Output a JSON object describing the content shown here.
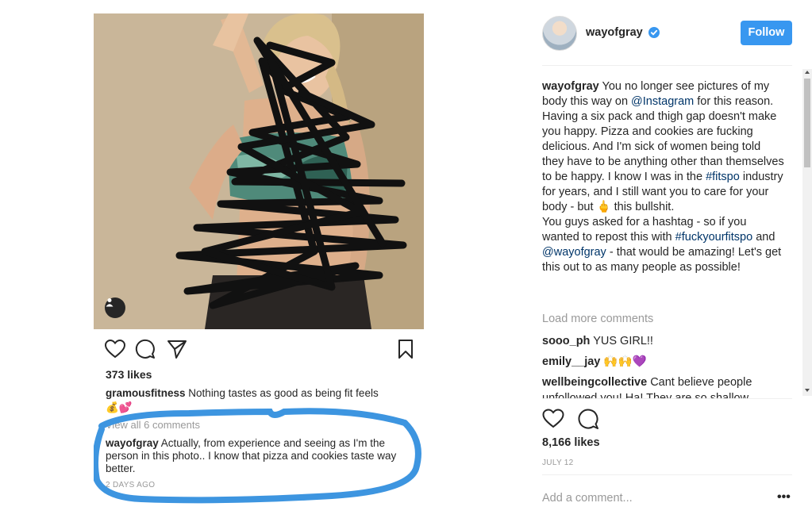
{
  "left_post": {
    "likes": "373 likes",
    "caption": {
      "username": "gramousfitness",
      "text": "Nothing tastes as good as being fit feels 💰💕"
    },
    "view_all_comments": "View all 6 comments",
    "comment": {
      "username": "wayofgray",
      "text": "Actually, from experience and seeing as I'm the person in this photo.. I know that pizza and cookies taste way better."
    },
    "timestamp": "2 DAYS AGO",
    "icons": [
      "heart-icon",
      "comment-icon",
      "share-icon",
      "bookmark-icon",
      "user-tag-icon"
    ],
    "annotation_color": "#3d95e0"
  },
  "post": {
    "username": "wayofgray",
    "follow_label": "Follow",
    "caption": {
      "username": "wayofgray",
      "p1": " You no longer see pictures of my body this way on ",
      "mention1": "@Instagram",
      "p2": " for this reason. Having a six pack and thigh gap doesn't make you happy. Pizza and cookies are fucking delicious. And I'm sick of women being told they have to be anything other than themselves to be happy. I know I was in the ",
      "hashtag1": "#fitspo",
      "p3": " industry for years, and I still want you to care for your body - but 🖕 this bullshit.",
      "p4": "You guys asked for a hashtag - so if you wanted to repost this with ",
      "hashtag2": "#fuckyourfitspo",
      "p5": " and ",
      "mention2": "@wayofgray",
      "p6": " - that would be amazing! Let's get this out to as many people as possible!"
    },
    "load_more": "Load more comments",
    "comments": [
      {
        "username": "sooo_ph",
        "text": "YUS GIRL!!"
      },
      {
        "username": "emily__jay",
        "text": "🙌🙌💜"
      },
      {
        "username": "wellbeingcollective",
        "text": "Cant believe people unfollowed you! Ha! They are so shallow"
      }
    ],
    "likes": "8,166 likes",
    "date": "JULY 12",
    "add_comment_placeholder": "Add a comment...",
    "more_label": "•••",
    "colors": {
      "accent": "#3897f0",
      "link": "#003569",
      "muted": "#999999"
    }
  }
}
